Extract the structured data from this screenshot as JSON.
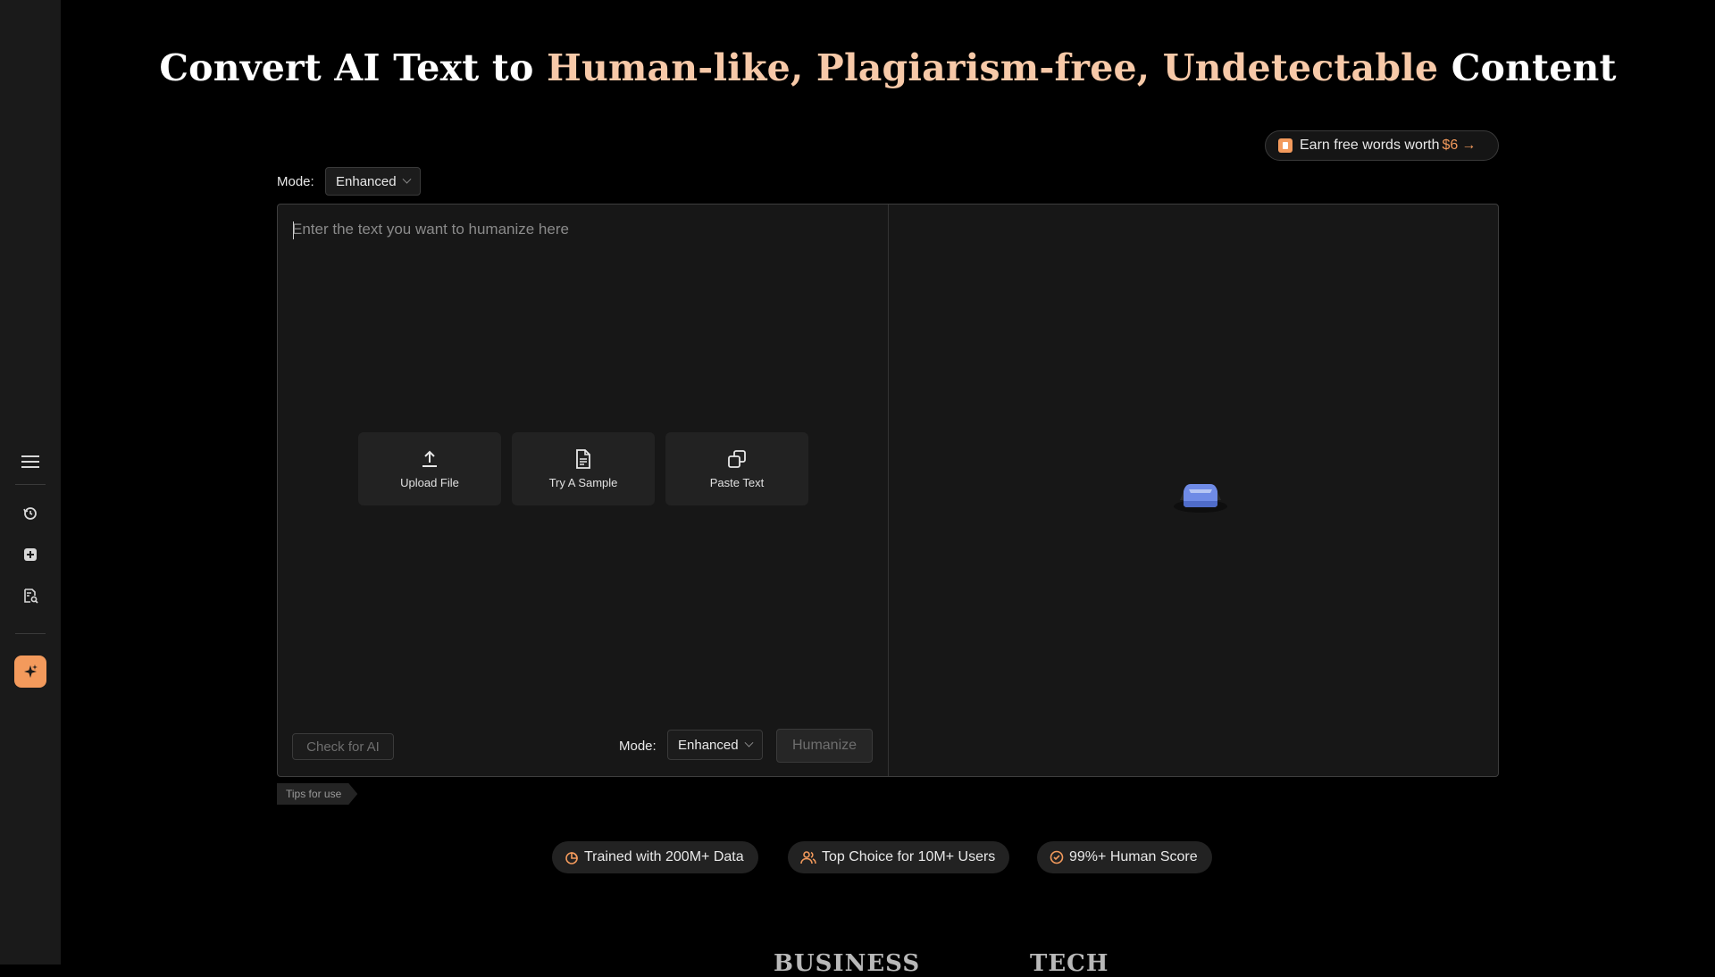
{
  "title": {
    "part1": "Convert AI Text to ",
    "highlight1": "Human-like, Plagiarism-free, Undetectable",
    "part2": " Content"
  },
  "sidebar": {
    "items": [
      {
        "icon": "menu-icon"
      },
      {
        "icon": "history-icon"
      },
      {
        "icon": "add-square-icon"
      },
      {
        "icon": "document-search-icon"
      },
      {
        "icon": "sparkle-icon",
        "active": true
      }
    ]
  },
  "earn": {
    "label": "Earn free words worth",
    "amount": "$6",
    "arrow": "→"
  },
  "mode_top": {
    "label": "Mode:",
    "value": "Enhanced"
  },
  "editor": {
    "placeholder": "Enter the text you want to humanize here",
    "actions": [
      {
        "label": "Upload File",
        "icon": "upload-icon"
      },
      {
        "label": "Try A Sample",
        "icon": "document-icon"
      },
      {
        "label": "Paste Text",
        "icon": "copy-icon"
      }
    ],
    "check_label": "Check for AI",
    "mode_label": "Mode:",
    "mode_value": "Enhanced",
    "humanize_label": "Humanize"
  },
  "tips": {
    "label": "Tips for use"
  },
  "badges": [
    {
      "label": "Trained with 200M+ Data",
      "icon": "chart-icon"
    },
    {
      "label": "Top Choice for 10M+ Users",
      "icon": "users-icon"
    },
    {
      "label": "99%+ Human Score",
      "icon": "check-circle-icon"
    }
  ],
  "logos": [
    "BUSINESS",
    "TECH"
  ],
  "colors": {
    "accent": "#f39a5c",
    "highlight": "#f7c9a8",
    "background": "#000000",
    "sidebar": "#1a1a1a"
  }
}
